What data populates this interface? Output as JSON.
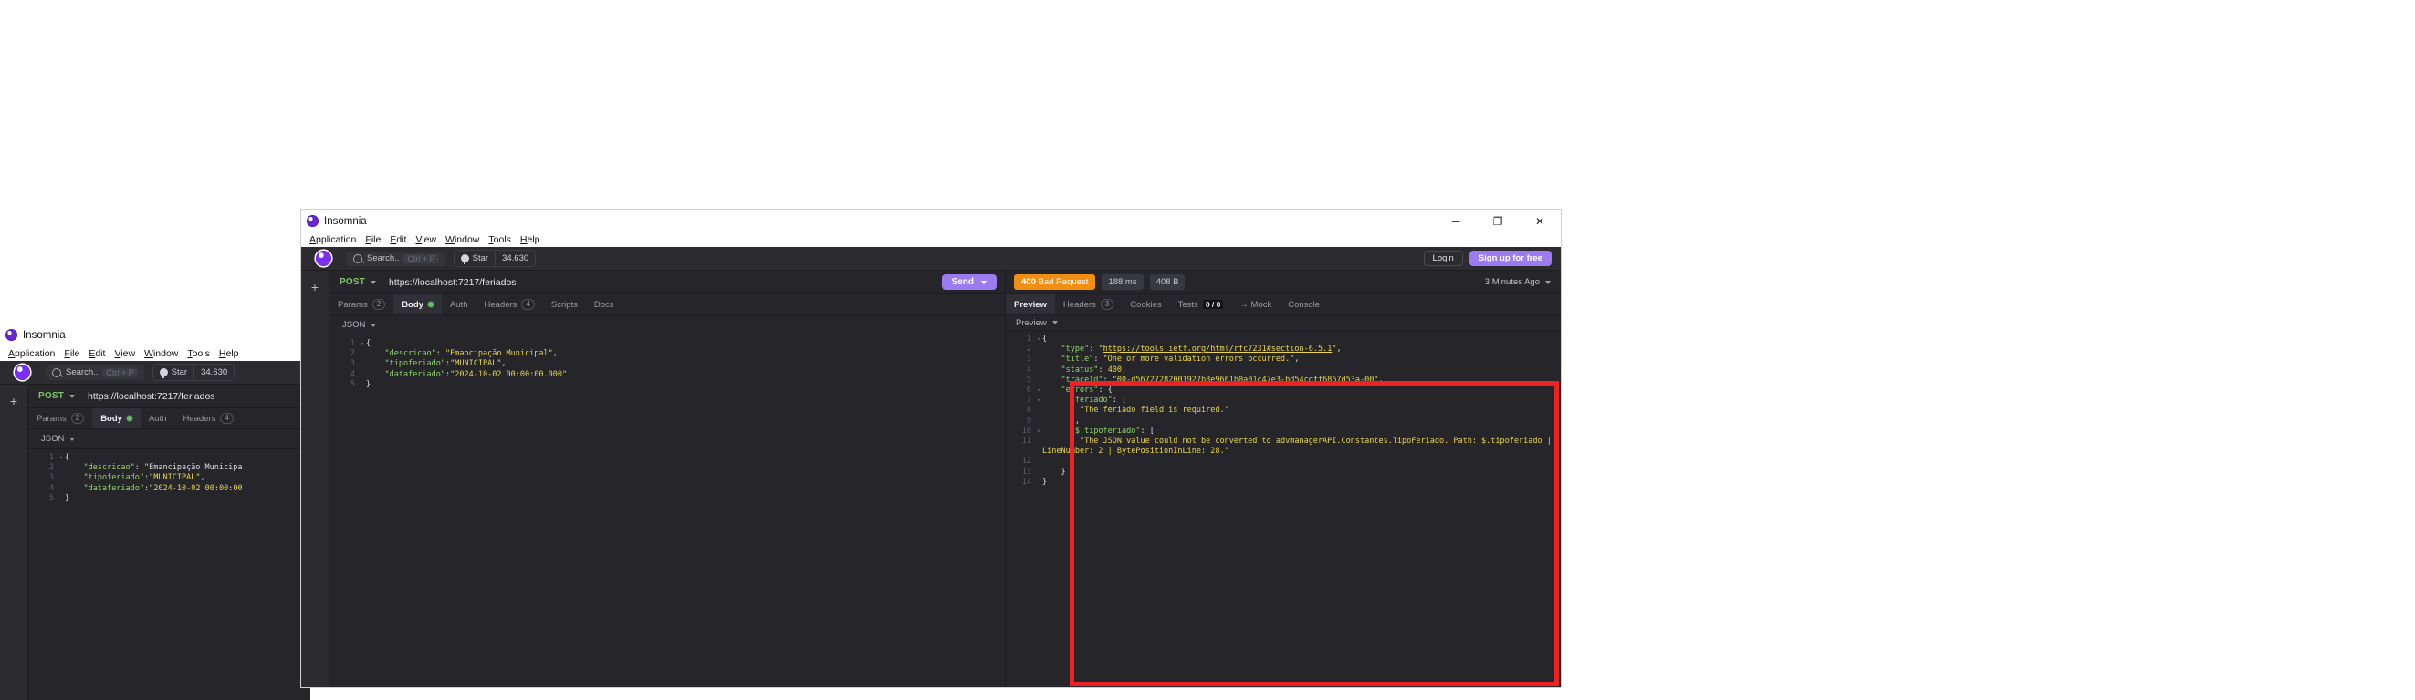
{
  "window_back": {
    "title": "Insomnia",
    "menu": [
      "Application",
      "File",
      "Edit",
      "View",
      "Window",
      "Tools",
      "Help"
    ],
    "search": {
      "label": "Search..",
      "shortcut": "Ctrl + P"
    },
    "github": {
      "label": "Star",
      "count": "34.630"
    },
    "request": {
      "method": "POST",
      "url": "https://localhost:7217/feriados"
    },
    "tabs": [
      {
        "label": "Params",
        "badge": "2"
      },
      {
        "label": "Body",
        "badge": "dot"
      },
      {
        "label": "Auth",
        "badge": ""
      },
      {
        "label": "Headers",
        "badge": "4"
      }
    ],
    "body_format": "JSON",
    "body_lines": [
      {
        "n": "1",
        "fold": "▾",
        "text": "{"
      },
      {
        "n": "2",
        "fold": "",
        "text": "    \"descricao\": \"Emancipação Municipa"
      },
      {
        "n": "3",
        "fold": "",
        "text": "    \"tipoferiado\":\"MUNICIPAL\","
      },
      {
        "n": "4",
        "fold": "",
        "text": "    \"dataferiado\":\"2024-10-02 00:00:00"
      },
      {
        "n": "5",
        "fold": "",
        "text": "}"
      }
    ]
  },
  "window_front": {
    "title": "Insomnia",
    "menu": [
      "Application",
      "File",
      "Edit",
      "View",
      "Window",
      "Tools",
      "Help"
    ],
    "controls": {
      "minimize": "─",
      "maximize": "❐",
      "close": "✕"
    },
    "search": {
      "label": "Search..",
      "shortcut": "Ctrl + P"
    },
    "github": {
      "label": "Star",
      "count": "34.630"
    },
    "account": {
      "login": "Login",
      "signup": "Sign up for free"
    },
    "sidebar": {
      "add": "+"
    },
    "request": {
      "method": "POST",
      "url": "https://localhost:7217/feriados",
      "send": "Send",
      "tabs": [
        {
          "label": "Params",
          "badge": "2",
          "active": false
        },
        {
          "label": "Body",
          "badge": "dot",
          "active": true
        },
        {
          "label": "Auth",
          "badge": "",
          "active": false
        },
        {
          "label": "Headers",
          "badge": "4",
          "active": false
        },
        {
          "label": "Scripts",
          "badge": "",
          "active": false
        },
        {
          "label": "Docs",
          "badge": "",
          "active": false
        }
      ],
      "body_format": "JSON",
      "body_lines": [
        {
          "n": "1",
          "fold": "▾",
          "text": "{"
        },
        {
          "n": "2",
          "fold": "",
          "text": "    \"descricao\": \"Emancipação Municipal\","
        },
        {
          "n": "3",
          "fold": "",
          "text": "    \"tipoferiado\":\"MUNICIPAL\","
        },
        {
          "n": "4",
          "fold": "",
          "text": "    \"dataferiado\":\"2024-10-02 00:00:00.000\""
        },
        {
          "n": "5",
          "fold": "",
          "text": "}"
        }
      ]
    },
    "response": {
      "status_code": "400",
      "status_text": "Bad Request",
      "time": "188 ms",
      "size": "408 B",
      "timestamp": "3 Minutes Ago",
      "tabs": [
        {
          "label": "Preview",
          "badge": "",
          "active": true
        },
        {
          "label": "Headers",
          "badge": "3",
          "active": false
        },
        {
          "label": "Cookies",
          "badge": "",
          "active": false
        },
        {
          "label": "Tests",
          "badge": "0 / 0",
          "active": false
        },
        {
          "label": "→ Mock",
          "badge": "",
          "active": false
        },
        {
          "label": "Console",
          "badge": "",
          "active": false
        }
      ],
      "view_mode": "Preview",
      "body_lines": [
        {
          "n": "1",
          "fold": "▾",
          "text": "{"
        },
        {
          "n": "2",
          "fold": "",
          "text": "    \"type\": \"https://tools.ietf.org/html/rfc7231#section-6.5.1\","
        },
        {
          "n": "3",
          "fold": "",
          "text": "    \"title\": \"One or more validation errors occurred.\","
        },
        {
          "n": "4",
          "fold": "",
          "text": "    \"status\": 400,"
        },
        {
          "n": "5",
          "fold": "",
          "text": "    \"traceId\": \"00-d56727282001927b8e9661b0a01c47e3-bd54cdff6867d53a-00\","
        },
        {
          "n": "6",
          "fold": "▾",
          "text": "    \"errors\": {"
        },
        {
          "n": "7",
          "fold": "▾",
          "text": "      \"feriado\": ["
        },
        {
          "n": "8",
          "fold": "",
          "text": "        \"The feriado field is required.\""
        },
        {
          "n": "9",
          "fold": "",
          "text": "      ],"
        },
        {
          "n": "10",
          "fold": "▾",
          "text": "      \"$.tipoferiado\": ["
        },
        {
          "n": "11",
          "fold": "",
          "text": "        \"The JSON value could not be converted to advmanagerAPI.Constantes.TipoFeriado. Path: $.tipoferiado | LineNumber: 2 | BytePositionInLine: 28.\""
        },
        {
          "n": "12",
          "fold": "",
          "text": "      ]"
        },
        {
          "n": "13",
          "fold": "",
          "text": "    }"
        },
        {
          "n": "14",
          "fold": "",
          "text": "}"
        }
      ]
    }
  },
  "annotation": {
    "color": "#ee2222",
    "shape": "rectangle"
  }
}
